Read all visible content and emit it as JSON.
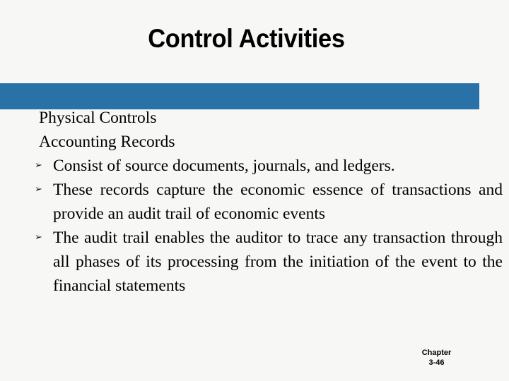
{
  "slide": {
    "title": "Control Activities",
    "accent_bar_color": "#2872a8",
    "background_color": "#f7f7f5",
    "text_color": "#000000"
  },
  "body": {
    "lead_lines": [
      "Physical Controls",
      "Accounting Records"
    ],
    "bullet_marker": "➢",
    "bullets": [
      "Consist of source documents, journals, and ledgers.",
      "These records capture the economic essence of transactions and provide an audit trail of economic events",
      "The audit trail enables the auditor to trace  any transaction through all phases of its processing from the initiation of the event to the financial statements"
    ]
  },
  "footer": {
    "label": "Chapter",
    "number": "3-46"
  }
}
